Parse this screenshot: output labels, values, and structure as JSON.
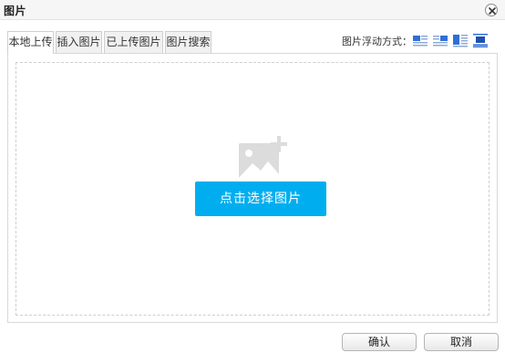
{
  "dialog": {
    "title": "图片",
    "close_icon": "close-icon"
  },
  "tabs": [
    {
      "label": "本地上传",
      "active": true
    },
    {
      "label": "插入图片",
      "active": false
    },
    {
      "label": "已上传图片",
      "active": false
    },
    {
      "label": "图片搜索",
      "active": false
    }
  ],
  "float_options": {
    "label": "图片浮动方式：",
    "icons": [
      "float-left-icon",
      "float-right-icon",
      "float-none-icon",
      "float-center-icon"
    ]
  },
  "upload": {
    "icon": "image-add-icon",
    "button_label": "点击选择图片"
  },
  "footer": {
    "confirm_label": "确认",
    "cancel_label": "取消"
  },
  "colors": {
    "accent": "#00aeef",
    "icon_blue": "#2f6fd6"
  }
}
